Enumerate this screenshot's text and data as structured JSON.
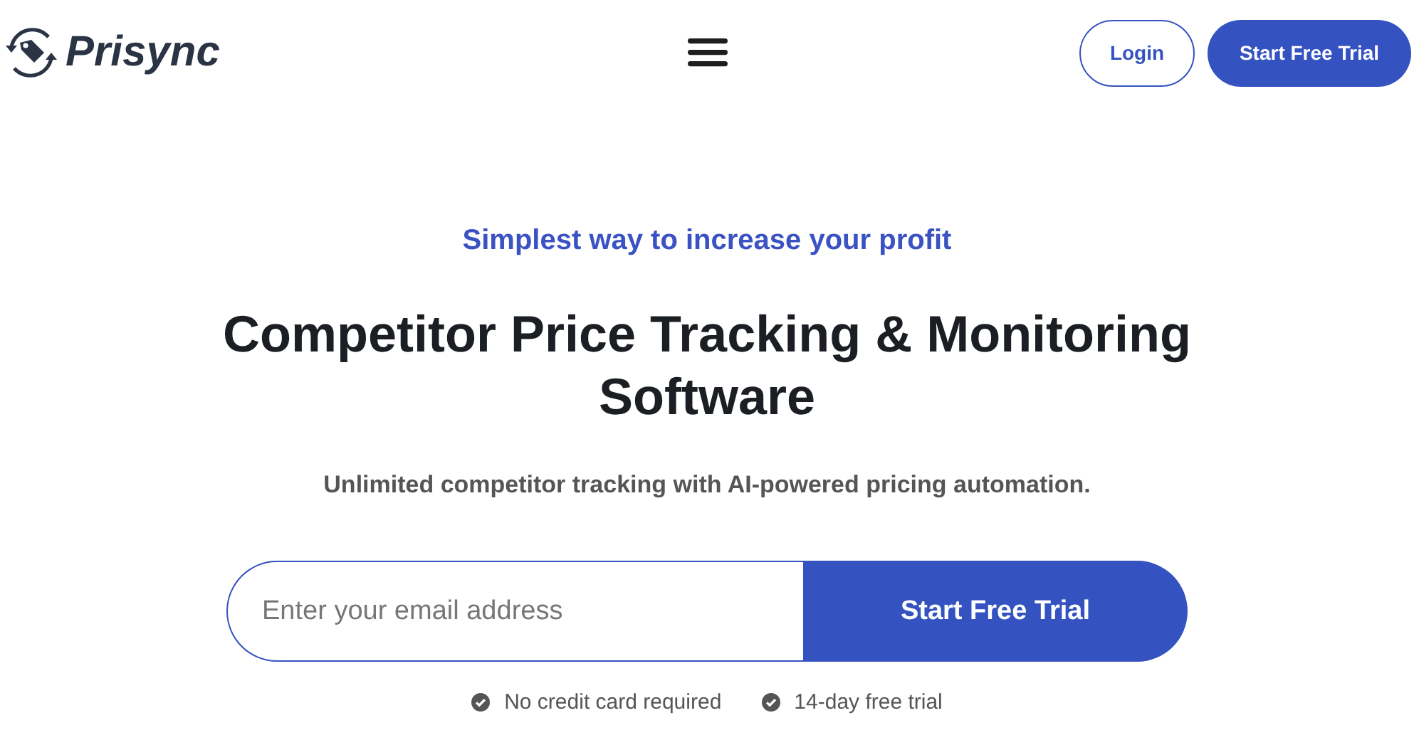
{
  "header": {
    "logo_text": "Prisync",
    "login": "Login",
    "cta": "Start Free Trial"
  },
  "hero": {
    "tagline": "Simplest way to increase your profit",
    "title": "Competitor Price Tracking & Monitoring Software",
    "subtitle": "Unlimited competitor tracking with AI-powered pricing automation.",
    "form": {
      "placeholder": "Enter your email address",
      "button": "Start Free Trial"
    },
    "features": [
      "No credit card required",
      "14-day free trial"
    ]
  }
}
